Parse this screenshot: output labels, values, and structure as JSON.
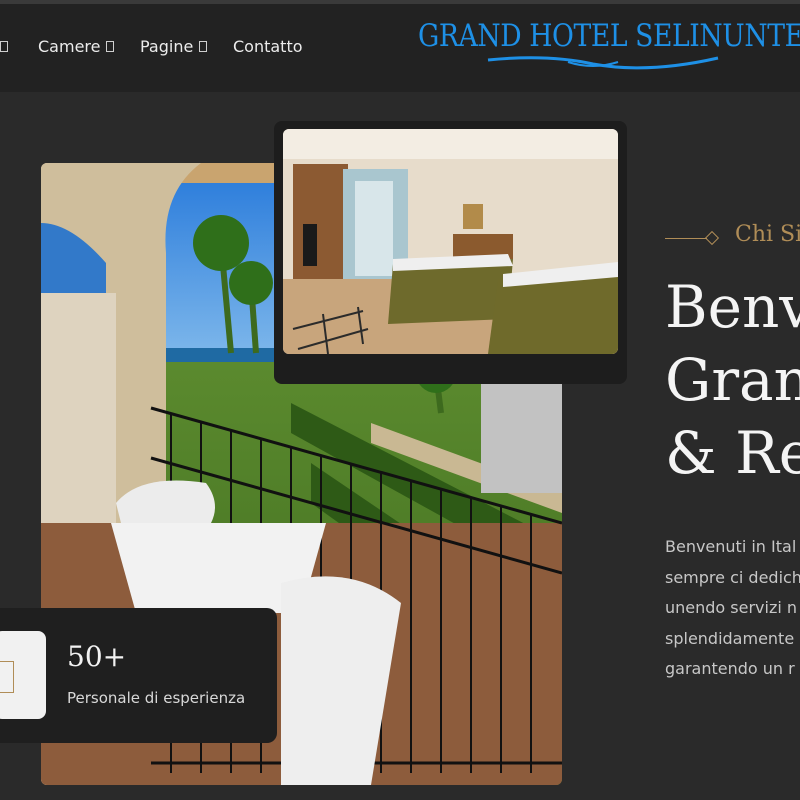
{
  "nav": {
    "items": [
      {
        "label": "",
        "has_caret": true
      },
      {
        "label": "Camere",
        "has_caret": true
      },
      {
        "label": "Pagine",
        "has_caret": true
      },
      {
        "label": "Contatto",
        "has_caret": false
      }
    ]
  },
  "logo": {
    "text": "GRAND HOTEL SELINUNTE",
    "color": "#1e90e6"
  },
  "stat": {
    "number": "50+",
    "label": "Personale di esperienza"
  },
  "about": {
    "eyebrow": "Chi Si",
    "headline_lines": [
      "Benv",
      "Gran",
      "& Re"
    ],
    "body_lines": [
      "Benvenuti in Ital",
      "sempre ci dedich",
      "unendo servizi n",
      "splendidamente",
      "garantendo un r"
    ]
  },
  "colors": {
    "accent": "#b08d57",
    "background": "#2a2a2a",
    "navbar": "#222222"
  }
}
